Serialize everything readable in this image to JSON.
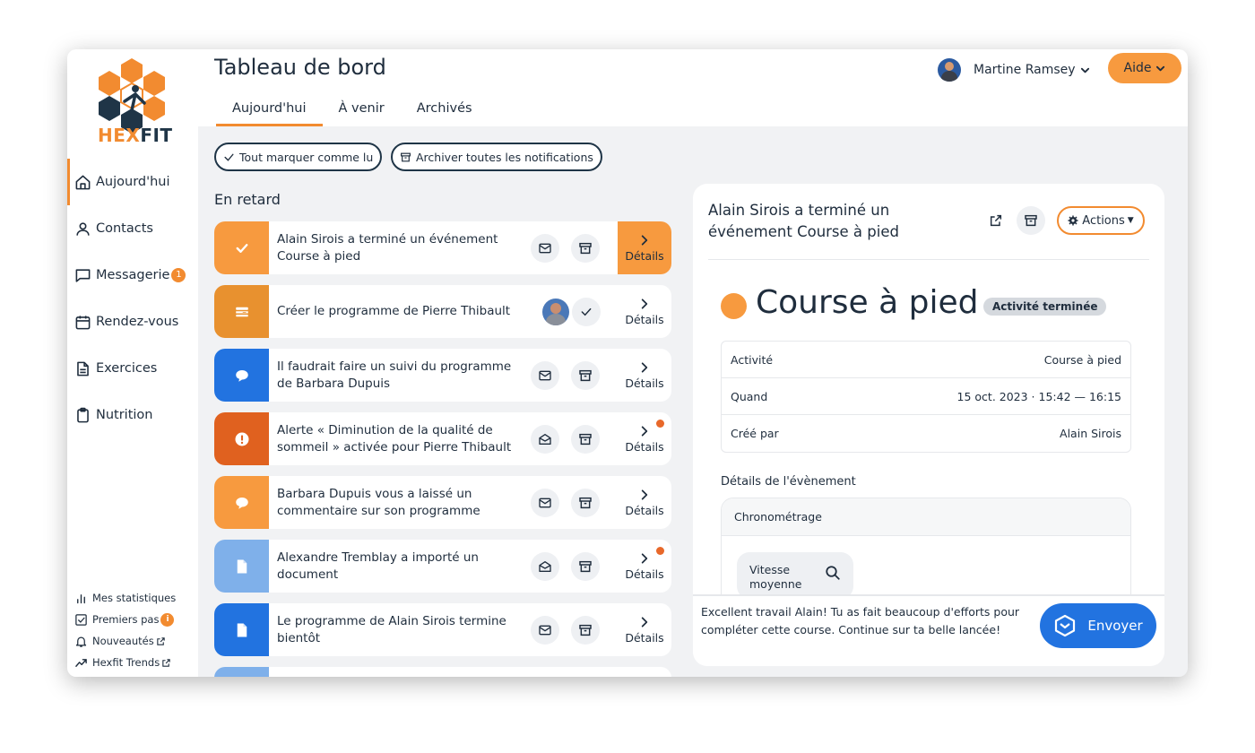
{
  "brand": {
    "part1": "HEX",
    "part2": "FIT"
  },
  "sidebar": {
    "items": [
      {
        "label": "Aujourd'hui",
        "icon": "home-icon",
        "active": true
      },
      {
        "label": "Contacts",
        "icon": "user-icon"
      },
      {
        "label": "Messagerie",
        "icon": "chat-icon",
        "badge": "1"
      },
      {
        "label": "Rendez-vous",
        "icon": "calendar-icon"
      },
      {
        "label": "Exercices",
        "icon": "document-icon"
      },
      {
        "label": "Nutrition",
        "icon": "clipboard-icon"
      }
    ],
    "footer": [
      {
        "label": "Mes statistiques",
        "icon": "bar-chart-icon"
      },
      {
        "label": "Premiers pas",
        "icon": "checklist-icon",
        "badge": "i"
      },
      {
        "label": "Nouveautés",
        "icon": "bell-icon",
        "external": true
      },
      {
        "label": "Hexfit Trends",
        "icon": "trend-icon",
        "external": true
      }
    ]
  },
  "header": {
    "title": "Tableau de bord",
    "tabs": [
      {
        "label": "Aujourd'hui",
        "active": true
      },
      {
        "label": "À venir"
      },
      {
        "label": "Archivés"
      }
    ],
    "user": "Martine Ramsey",
    "help": "Aide"
  },
  "bulk_actions": {
    "mark_all_read": "Tout marquer comme lu",
    "archive_all": "Archiver toutes les notifications"
  },
  "overdue": {
    "title": "En retard",
    "details_label": "Détails",
    "items": [
      {
        "text": "Alain Sirois a terminé un événement Course à pied",
        "icon": "check-icon",
        "color": "#f79a3f",
        "highlight": true
      },
      {
        "text": "Créer le programme de Pierre Thibault",
        "icon": "list-icon",
        "color": "#e8912f",
        "variant": "task"
      },
      {
        "text": "Il faudrait faire un suivi du programme de Barbara Dupuis",
        "icon": "comment-icon",
        "color": "#2273e0"
      },
      {
        "text": "Alerte « Diminution de la qualité de sommeil » activée pour  Pierre Thibault",
        "icon": "alert-icon",
        "color": "#e0611f",
        "unread_dot": true,
        "opened": true
      },
      {
        "text": "Barbara Dupuis vous a laissé un commentaire sur son programme",
        "icon": "comment-icon",
        "color": "#f79a3f"
      },
      {
        "text": "Alexandre  Tremblay a importé un document",
        "icon": "file-icon",
        "color": "#7fb0ea",
        "unread_dot": true,
        "opened": true
      },
      {
        "text": "Le programme de Alain Sirois termine bientôt",
        "icon": "file-icon",
        "color": "#2273e0"
      },
      {
        "text": "",
        "icon": "",
        "color": "#7fb0ea"
      }
    ]
  },
  "panel": {
    "title": "Alain Sirois a terminé un événement Course à pied",
    "actions_label": "Actions",
    "event_title": "Course à pied",
    "event_color": "#f79a3f",
    "status": "Activité terminée",
    "info": [
      {
        "label": "Activité",
        "value": "Course à pied"
      },
      {
        "label": "Quand",
        "value": "15 oct. 2023 · 15:42 — 16:15"
      },
      {
        "label": "Créé par",
        "value": "Alain Sirois"
      }
    ],
    "details_heading": "Détails de l'évènement",
    "chrono_heading": "Chronométrage",
    "speed_line1": "Vitesse",
    "speed_line2": "moyenne",
    "message": "Excellent travail Alain! Tu as fait beaucoup d'efforts pour compléter cette course. Continue sur ta belle lancée!",
    "send_label": "Envoyer"
  },
  "colors": {
    "accent": "#f28b30",
    "primary": "#2273e0",
    "text": "#1f2d3d",
    "background": "#f1f2f4"
  }
}
